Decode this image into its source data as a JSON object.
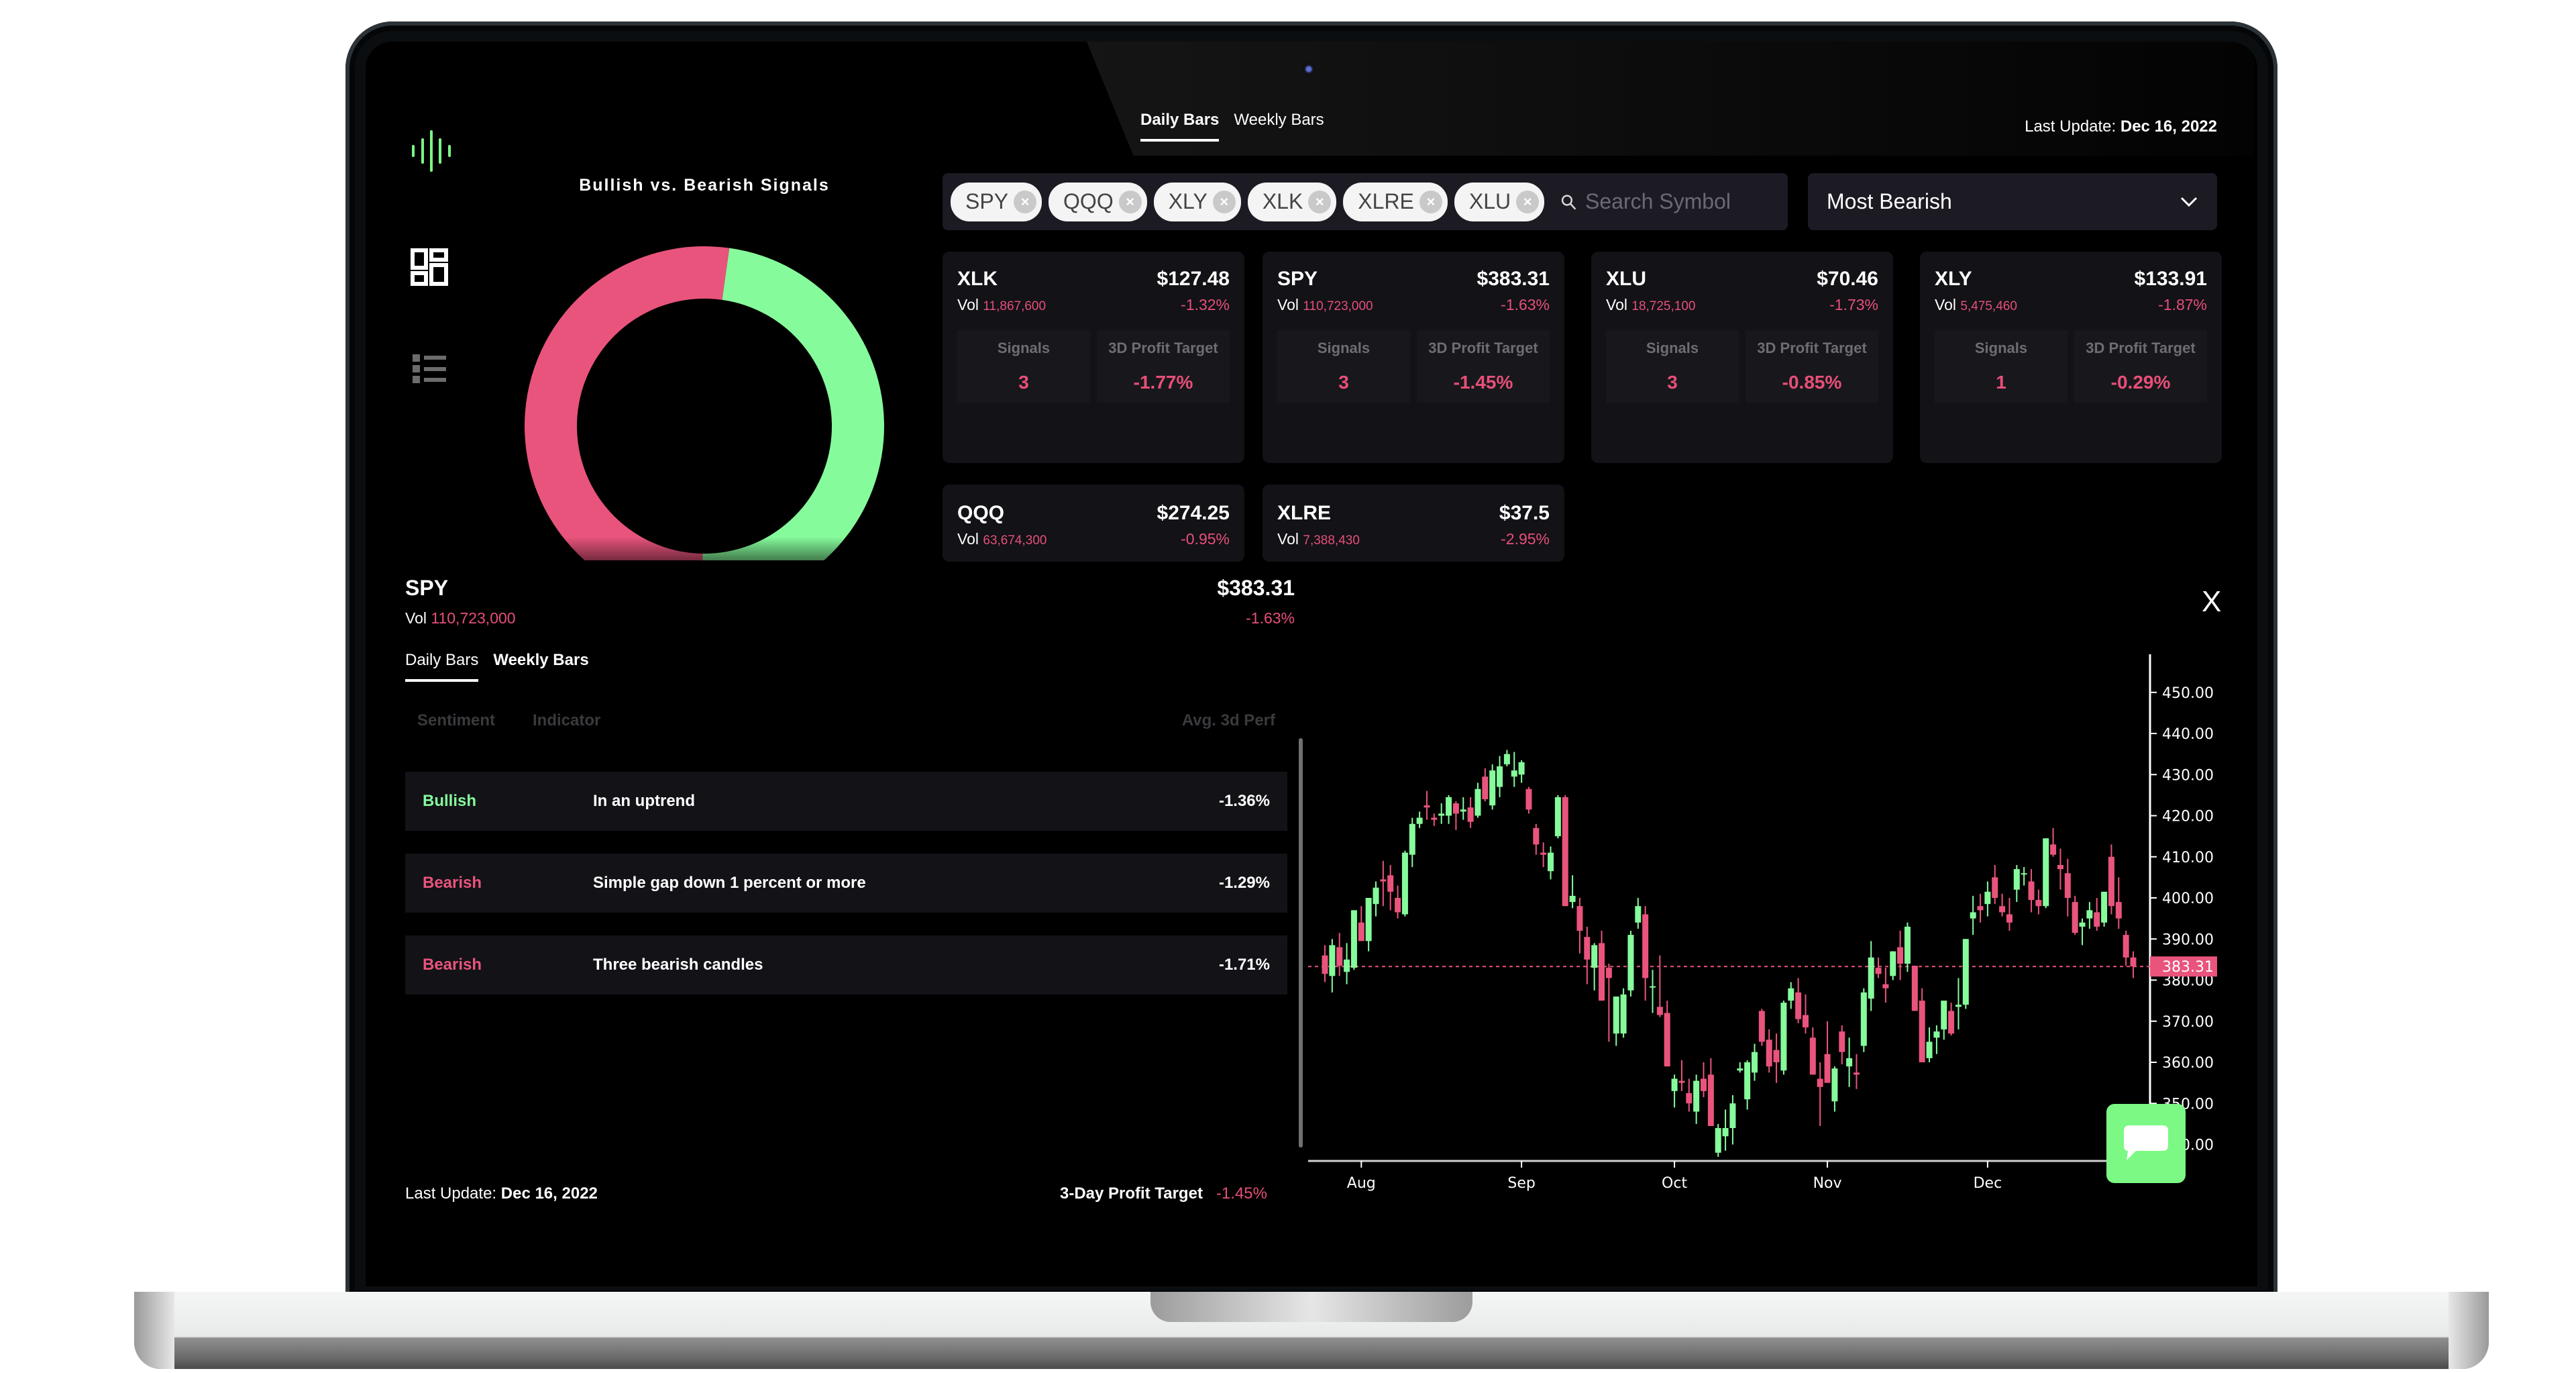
{
  "sidebar": {
    "logo": "waveform-logo",
    "items": [
      {
        "name": "dashboard",
        "icon": "dashboard-grid-icon",
        "active": true
      },
      {
        "name": "list",
        "icon": "list-icon",
        "active": false
      }
    ]
  },
  "donut": {
    "title": "Bullish vs. Bearish Signals"
  },
  "header": {
    "tabs": [
      {
        "label": "Daily Bars",
        "active": true
      },
      {
        "label": "Weekly Bars",
        "active": false
      }
    ],
    "last_update_label": "Last Update:",
    "last_update_value": "Dec 16, 2022"
  },
  "filter": {
    "chips": [
      "SPY",
      "QQQ",
      "XLY",
      "XLK",
      "XLRE",
      "XLU"
    ],
    "chip_remove_glyph": "×",
    "search_placeholder": "Search Symbol",
    "search_value": "",
    "sort_selected": "Most Bearish"
  },
  "cards": [
    {
      "symbol": "XLK",
      "price": "$127.48",
      "vol_label": "Vol",
      "volume": "11,867,600",
      "change": "-1.32%",
      "signals_label": "Signals",
      "signals": "3",
      "target_label": "3D Profit Target",
      "target": "-1.77%"
    },
    {
      "symbol": "SPY",
      "price": "$383.31",
      "vol_label": "Vol",
      "volume": "110,723,000",
      "change": "-1.63%",
      "signals_label": "Signals",
      "signals": "3",
      "target_label": "3D Profit Target",
      "target": "-1.45%"
    },
    {
      "symbol": "XLU",
      "price": "$70.46",
      "vol_label": "Vol",
      "volume": "18,725,100",
      "change": "-1.73%",
      "signals_label": "Signals",
      "signals": "3",
      "target_label": "3D Profit Target",
      "target": "-0.85%"
    },
    {
      "symbol": "XLY",
      "price": "$133.91",
      "vol_label": "Vol",
      "volume": "5,475,460",
      "change": "-1.87%",
      "signals_label": "Signals",
      "signals": "1",
      "target_label": "3D Profit Target",
      "target": "-0.29%"
    },
    {
      "symbol": "QQQ",
      "price": "$274.25",
      "vol_label": "Vol",
      "volume": "63,674,300",
      "change": "-0.95%"
    },
    {
      "symbol": "XLRE",
      "price": "$37.5",
      "vol_label": "Vol",
      "volume": "7,388,430",
      "change": "-2.95%"
    }
  ],
  "detail": {
    "symbol": "SPY",
    "price": "$383.31",
    "vol_label": "Vol",
    "volume": "110,723,000",
    "change": "-1.63%",
    "close_label": "X",
    "tabs": [
      {
        "label": "Daily Bars",
        "active": true
      },
      {
        "label": "Weekly Bars",
        "active": false
      }
    ],
    "table": {
      "headers": [
        "Sentiment",
        "Indicator",
        "Avg. 3d Perf"
      ],
      "rows": [
        {
          "sentiment": "Bullish",
          "indicator": "In an uptrend",
          "perf": "-1.36%"
        },
        {
          "sentiment": "Bearish",
          "indicator": "Simple gap down 1 percent or more",
          "perf": "-1.29%"
        },
        {
          "sentiment": "Bearish",
          "indicator": "Three bearish candles",
          "perf": "-1.71%"
        }
      ]
    },
    "footer": {
      "last_update_label": "Last Update:",
      "last_update_value": "Dec 16, 2022",
      "target_label": "3-Day Profit Target",
      "target_value": "-1.45%"
    }
  },
  "colors": {
    "bullish": "#86fb9c",
    "bearish": "#e9547c",
    "card_bg": "#121217",
    "panel_bg": "#1c1b24",
    "chat_button": "#7cf884"
  },
  "chat_button": {
    "icon": "chat-bubble-icon"
  },
  "chart_data": [
    {
      "type": "pie",
      "title": "Bullish vs. Bearish Signals",
      "categories": [
        "Bearish",
        "Bullish"
      ],
      "values": [
        52,
        48
      ],
      "colors": [
        "#e9547c",
        "#86fb9c"
      ],
      "donut": true
    },
    {
      "type": "candlestick",
      "title": "SPY Daily Bars",
      "xlabel": "",
      "ylabel": "",
      "x_ticks": [
        "Aug",
        "Sep",
        "Oct",
        "Nov",
        "Dec"
      ],
      "y_ticks": [
        "450.00",
        "440.00",
        "430.00",
        "420.00",
        "410.00",
        "400.00",
        "390.00",
        "380.00",
        "370.00",
        "360.00",
        "350.00",
        "340.00"
      ],
      "ylim": [
        336,
        456
      ],
      "last_price_label": "383.31",
      "last_price": 383.31,
      "month_start_index": {
        "Aug": 5,
        "Sep": 27,
        "Oct": 48,
        "Nov": 69,
        "Dec": 91
      },
      "ohlc": [
        [
          386.0,
          388.5,
          379.5,
          381.5
        ],
        [
          381.0,
          390.0,
          377.0,
          388.5
        ],
        [
          388.0,
          391.5,
          381.0,
          383.5
        ],
        [
          382.0,
          389.0,
          379.0,
          385.0
        ],
        [
          383.0,
          397.0,
          382.5,
          397.0
        ],
        [
          394.0,
          398.0,
          389.5,
          389.5
        ],
        [
          389.5,
          400.0,
          387.0,
          400.0
        ],
        [
          398.5,
          404.0,
          395.5,
          402.5
        ],
        [
          404.5,
          409.0,
          398.0,
          404.0
        ],
        [
          405.5,
          408.0,
          397.0,
          401.5
        ],
        [
          400.0,
          403.0,
          395.0,
          396.5
        ],
        [
          396.0,
          411.5,
          395.5,
          411.0
        ],
        [
          410.5,
          419.5,
          407.5,
          418.0
        ],
        [
          418.0,
          421.0,
          417.0,
          419.5
        ],
        [
          422.5,
          426.0,
          419.0,
          422.0
        ],
        [
          419.5,
          420.5,
          417.5,
          419.0
        ],
        [
          420.0,
          423.0,
          418.0,
          420.5
        ],
        [
          420.0,
          425.0,
          418.0,
          424.5
        ],
        [
          423.0,
          423.5,
          416.5,
          420.5
        ],
        [
          421.0,
          424.5,
          419.0,
          421.5
        ],
        [
          422.0,
          424.5,
          417.0,
          418.5
        ],
        [
          420.0,
          428.0,
          419.5,
          426.5
        ],
        [
          429.5,
          431.5,
          423.5,
          424.0
        ],
        [
          422.5,
          432.5,
          421.5,
          431.0
        ],
        [
          427.0,
          434.5,
          424.5,
          432.0
        ],
        [
          432.5,
          436.0,
          432.0,
          435.0
        ],
        [
          429.5,
          435.5,
          427.0,
          431.0
        ],
        [
          430.0,
          433.5,
          428.0,
          433.0
        ],
        [
          426.5,
          427.0,
          420.5,
          421.5
        ],
        [
          417.0,
          418.0,
          410.5,
          413.0
        ],
        [
          411.0,
          413.5,
          407.5,
          410.5
        ],
        [
          406.5,
          412.5,
          404.5,
          411.0
        ],
        [
          415.0,
          425.0,
          414.5,
          424.5
        ],
        [
          424.5,
          425.0,
          398.0,
          398.0
        ],
        [
          399.0,
          405.5,
          397.5,
          400.5
        ],
        [
          398.0,
          400.0,
          386.5,
          392.0
        ],
        [
          390.5,
          393.0,
          379.0,
          385.0
        ],
        [
          383.0,
          389.0,
          377.5,
          388.5
        ],
        [
          389.0,
          392.0,
          375.0,
          375.0
        ],
        [
          383.0,
          384.0,
          365.0,
          380.5
        ],
        [
          367.0,
          376.0,
          364.0,
          376.0
        ],
        [
          367.0,
          378.0,
          366.0,
          376.5
        ],
        [
          377.5,
          392.0,
          376.0,
          391.0
        ],
        [
          394.0,
          400.0,
          392.5,
          398.0
        ],
        [
          396.0,
          398.0,
          375.0,
          380.5
        ],
        [
          378.5,
          382.5,
          372.0,
          378.5
        ],
        [
          373.5,
          386.0,
          371.0,
          371.5
        ],
        [
          372.0,
          375.0,
          359.0,
          359.0
        ],
        [
          353.0,
          357.0,
          349.0,
          356.0
        ],
        [
          355.5,
          360.5,
          353.0,
          355.0
        ],
        [
          352.5,
          356.0,
          348.0,
          350.0
        ],
        [
          348.0,
          357.0,
          345.0,
          355.5
        ],
        [
          356.0,
          360.0,
          351.5,
          353.0
        ],
        [
          357.0,
          361.0,
          344.5,
          344.5
        ],
        [
          338.0,
          345.0,
          337.0,
          344.0
        ],
        [
          342.0,
          348.5,
          338.5,
          344.0
        ],
        [
          344.0,
          352.0,
          340.0,
          350.0
        ],
        [
          358.0,
          360.0,
          357.5,
          358.5
        ],
        [
          351.0,
          360.5,
          348.5,
          360.0
        ],
        [
          357.5,
          364.5,
          355.5,
          362.5
        ],
        [
          372.5,
          373.0,
          364.0,
          365.0
        ],
        [
          365.5,
          368.0,
          357.5,
          359.0
        ],
        [
          363.0,
          367.0,
          355.0,
          360.0
        ],
        [
          358.0,
          375.0,
          357.0,
          374.5
        ],
        [
          375.0,
          379.5,
          373.0,
          378.0
        ],
        [
          377.0,
          380.5,
          369.5,
          370.5
        ],
        [
          371.5,
          376.5,
          367.0,
          368.5
        ],
        [
          366.0,
          368.5,
          357.0,
          357.0
        ],
        [
          356.0,
          360.0,
          344.5,
          354.0
        ],
        [
          362.0,
          370.0,
          355.0,
          355.0
        ],
        [
          350.5,
          359.0,
          348.0,
          358.5
        ],
        [
          367.5,
          369.0,
          359.5,
          362.5
        ],
        [
          359.0,
          366.0,
          354.0,
          361.0
        ],
        [
          357.5,
          362.0,
          353.5,
          357.0
        ],
        [
          364.0,
          378.0,
          362.5,
          377.0
        ],
        [
          375.5,
          389.5,
          372.5,
          385.5
        ],
        [
          383.0,
          385.5,
          380.5,
          381.5
        ],
        [
          379.0,
          383.0,
          374.5,
          378.0
        ],
        [
          381.0,
          387.0,
          380.0,
          387.0
        ],
        [
          388.0,
          392.0,
          380.0,
          384.0
        ],
        [
          384.0,
          394.0,
          382.0,
          393.0
        ],
        [
          383.5,
          382.0,
          372.5,
          372.5
        ],
        [
          375.0,
          378.0,
          360.0,
          360.0
        ],
        [
          361.0,
          368.5,
          360.0,
          365.0
        ],
        [
          366.0,
          369.0,
          362.0,
          367.5
        ],
        [
          368.0,
          375.0,
          365.5,
          375.0
        ],
        [
          372.5,
          374.5,
          366.5,
          367.0
        ],
        [
          373.5,
          380.5,
          368.0,
          374.0
        ],
        [
          374.0,
          390.0,
          373.0,
          390.0
        ],
        [
          395.0,
          400.5,
          391.0,
          396.5
        ],
        [
          398.0,
          401.0,
          394.0,
          397.0
        ],
        [
          398.5,
          404.0,
          395.5,
          401.5
        ],
        [
          405.0,
          408.0,
          398.5,
          400.0
        ],
        [
          398.0,
          401.0,
          395.5,
          396.5
        ],
        [
          396.0,
          400.0,
          392.0,
          394.0
        ],
        [
          402.0,
          408.0,
          399.0,
          407.0
        ],
        [
          406.0,
          407.5,
          403.0,
          406.0
        ],
        [
          404.0,
          407.0,
          396.5,
          399.5
        ],
        [
          399.5,
          402.0,
          396.0,
          398.0
        ],
        [
          398.0,
          414.0,
          397.5,
          414.5
        ],
        [
          413.0,
          417.0,
          410.0,
          410.5
        ],
        [
          408.0,
          412.0,
          402.0,
          407.0
        ],
        [
          406.0,
          409.5,
          395.5,
          400.0
        ],
        [
          399.0,
          400.5,
          391.0,
          391.5
        ],
        [
          393.0,
          395.0,
          388.5,
          394.0
        ],
        [
          395.0,
          399.0,
          392.5,
          397.0
        ],
        [
          396.5,
          400.0,
          392.0,
          393.0
        ],
        [
          394.0,
          400.5,
          393.0,
          401.5
        ],
        [
          410.0,
          413.0,
          396.0,
          398.0
        ],
        [
          399.0,
          405.0,
          392.5,
          395.0
        ],
        [
          391.0,
          392.0,
          383.5,
          385.5
        ],
        [
          385.5,
          387.0,
          380.5,
          383.31
        ]
      ]
    }
  ]
}
